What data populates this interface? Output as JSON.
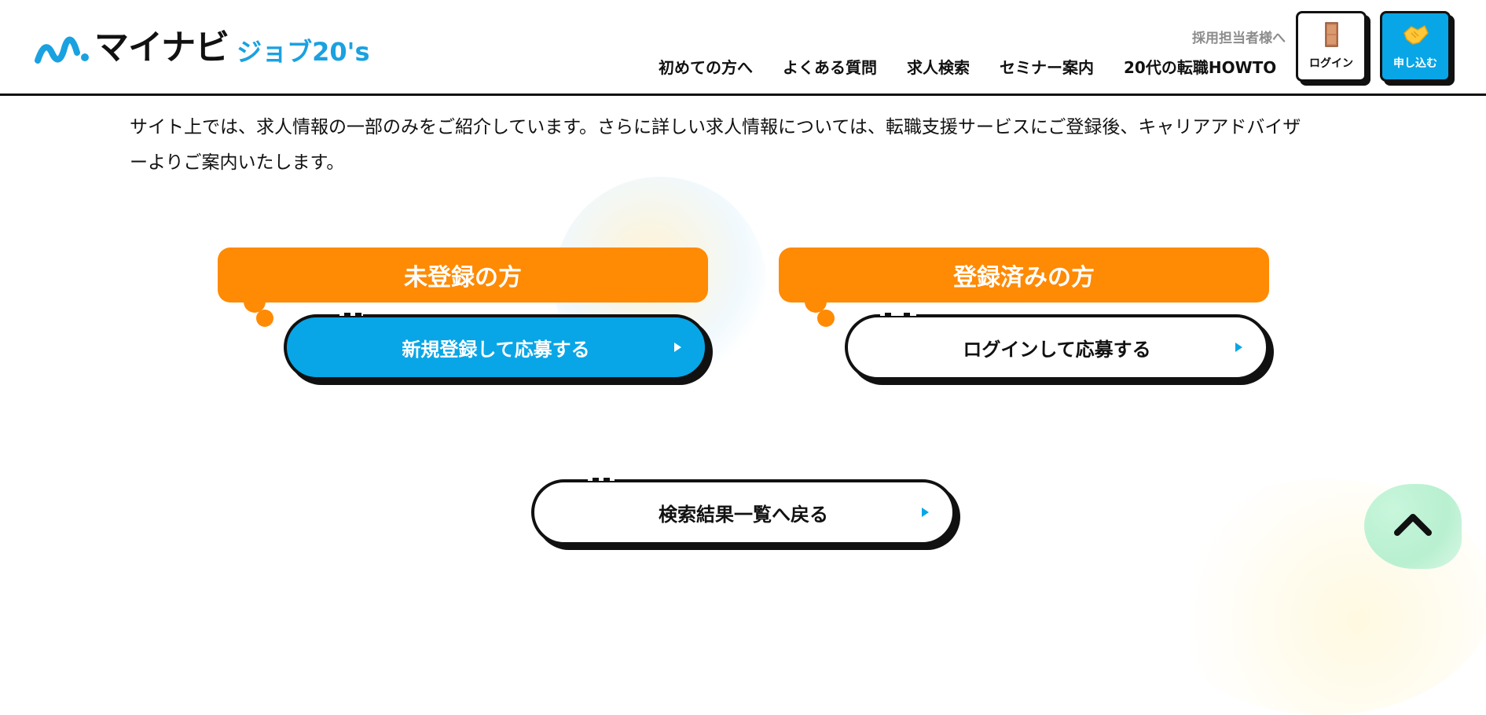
{
  "header": {
    "logo": {
      "main": "マイナビ",
      "sub": "ジョブ20's"
    },
    "employer_link": "採用担当者様へ",
    "nav": [
      {
        "label": "初めての方へ"
      },
      {
        "label": "よくある質問"
      },
      {
        "label": "求人検索"
      },
      {
        "label": "セミナー案内"
      },
      {
        "label": "20代の転職HOWTO"
      }
    ],
    "login_button": {
      "label": "ログイン",
      "icon": "door-icon"
    },
    "apply_button": {
      "label": "申し込む",
      "icon": "handshake-icon"
    }
  },
  "notice": {
    "line1": "サイト上では、求人情報の一部のみをご紹介しています。さらに詳しい求人情報については、転職支援サービスにご登録後、キャリアアドバイザ",
    "line2": "ーよりご案内いたします。"
  },
  "unregistered": {
    "heading": "未登録の方",
    "button": "新規登録して応募する"
  },
  "registered": {
    "heading": "登録済みの方",
    "button": "ログインして応募する"
  },
  "back_button": "検索結果一覧へ戻る",
  "page_top": {
    "icon": "chevron-up-icon"
  },
  "colors": {
    "accent_blue": "#08a6e6",
    "accent_orange": "#ff8a04",
    "logo_blue": "#1aa1e0",
    "page_top_green": "#b8f0d0"
  }
}
